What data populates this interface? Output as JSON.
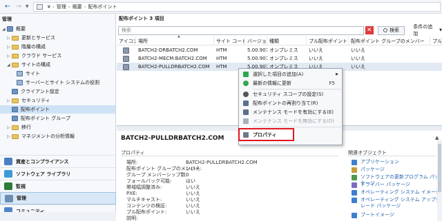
{
  "address": {
    "crumbs": [
      "¥",
      "管理",
      "概要",
      "配布ポイント"
    ]
  },
  "nav": {
    "title": "管理",
    "tree": [
      {
        "label": "概要",
        "expanded": true
      },
      {
        "label": "更新とサービス"
      },
      {
        "label": "階層の構成"
      },
      {
        "label": "クラウド サービス"
      },
      {
        "label": "サイトの構成",
        "expanded": true
      },
      {
        "label": "サイト"
      },
      {
        "label": "サーバーとサイト システムの役割"
      },
      {
        "label": "クライアント設定"
      },
      {
        "label": "セキュリティ"
      },
      {
        "label": "配布ポイント"
      },
      {
        "label": "配布ポイント グループ"
      },
      {
        "label": "移行"
      },
      {
        "label": "マネジメントの分析情報"
      }
    ],
    "workspaces": [
      {
        "label": "資産とコンプライアンス"
      },
      {
        "label": "ソフトウェア ライブラリ"
      },
      {
        "label": "監視"
      },
      {
        "label": "管理"
      },
      {
        "label": "コミュニティ"
      }
    ]
  },
  "list": {
    "header": "配布ポイント 3 項目",
    "search_placeholder": "検索",
    "search_button": "検索",
    "add_criteria": "条件の追加",
    "columns": [
      "アイコン",
      "場所",
      "サイト コード",
      "バージョン",
      "種類",
      "プル配布ポイント",
      "配布ポイント グループのメンバー",
      "プル"
    ],
    "rows": [
      {
        "name": "BATCH2-DRBATCH2.COM",
        "site": "HTM",
        "version": "5.00.907...",
        "type": "オンプレミス",
        "pull": "いいえ",
        "member": "いいえ"
      },
      {
        "name": "BATCH2-MECM.BATCH2.COM",
        "site": "HTM",
        "version": "5.00.907...",
        "type": "オンプレミス",
        "pull": "いいえ",
        "member": "いいえ"
      },
      {
        "name": "BATCH2-PULLDRBATCH2.COM",
        "site": "HTM",
        "version": "5.00.907...",
        "type": "オンプレミス",
        "pull": "いいえ",
        "member": "いいえ"
      }
    ]
  },
  "details": {
    "title": "BATCH2-PULLDRBATCH2.COM",
    "properties_label": "プロパティ",
    "related_label": "関連オブジェクト",
    "properties": [
      {
        "k": "場所:",
        "v": "BATCH2-PULLDRBATCH2.COM"
      },
      {
        "k": "配布ポイント グループのメンバー:",
        "v": "いいえ"
      },
      {
        "k": "グループ メンバーシップ数:",
        "v": "0"
      },
      {
        "k": "フォールバック可能:",
        "v": "はい"
      },
      {
        "k": "帯域幅調整済み:",
        "v": "いいえ"
      },
      {
        "k": "PXE:",
        "v": "いいえ"
      },
      {
        "k": "マルチキャスト:",
        "v": "いいえ"
      },
      {
        "k": "コンテンツの検証:",
        "v": "いいえ"
      },
      {
        "k": "プル配布ポイント:",
        "v": "いいえ"
      },
      {
        "k": "説明:",
        "v": ""
      }
    ],
    "related": [
      {
        "label": "アプリケーション",
        "color": "#3d7fcf"
      },
      {
        "label": "パッケージ",
        "color": "#c99a3a"
      },
      {
        "label": "ソフトウェアの更新プログラム パッケージ",
        "color": "#4a9a48"
      },
      {
        "label": "ドライバー パッケージ",
        "color": "#7a6cc0"
      },
      {
        "label": "オペレーティング システム イメージ",
        "color": "#3d7fcf"
      },
      {
        "label": "オペレーティング システム アップグレード パッケージ",
        "color": "#3d7fcf"
      },
      {
        "label": "ブートイメージ",
        "color": "#3d7fcf"
      }
    ]
  },
  "context_menu": {
    "items": [
      {
        "label": "選択した項目の追加(A)",
        "shortcut": "",
        "submenu": true,
        "icon_color": "#2fa84f",
        "disabled": false
      },
      {
        "label": "最新の情報に更新",
        "shortcut": "F5",
        "submenu": false,
        "icon_color": "#2fa84f",
        "disabled": false
      },
      {
        "label": "セキュリティ スコープの設定(S)",
        "shortcut": "",
        "submenu": false,
        "icon_color": "#555555",
        "disabled": false
      },
      {
        "label": "配布ポイントの再割り当て(R)",
        "shortcut": "",
        "submenu": false,
        "icon_color": "#5b6f8a",
        "disabled": false
      },
      {
        "label": "メンテナンス モードを有効にする(E)",
        "shortcut": "",
        "submenu": false,
        "icon_color": "#5b6f8a",
        "disabled": false
      },
      {
        "label": "メンテナンス モードを無効にする(D)",
        "shortcut": "",
        "submenu": false,
        "icon_color": "#a7b1bd",
        "disabled": true
      },
      {
        "label": "プロパティ",
        "shortcut": "",
        "submenu": false,
        "icon_color": "#6b7a8c",
        "disabled": false,
        "highlighted": true
      }
    ]
  },
  "colors": {
    "highlight_border": "#e0141d",
    "selection": "#cfe3f7",
    "link": "#1f5fa8"
  }
}
